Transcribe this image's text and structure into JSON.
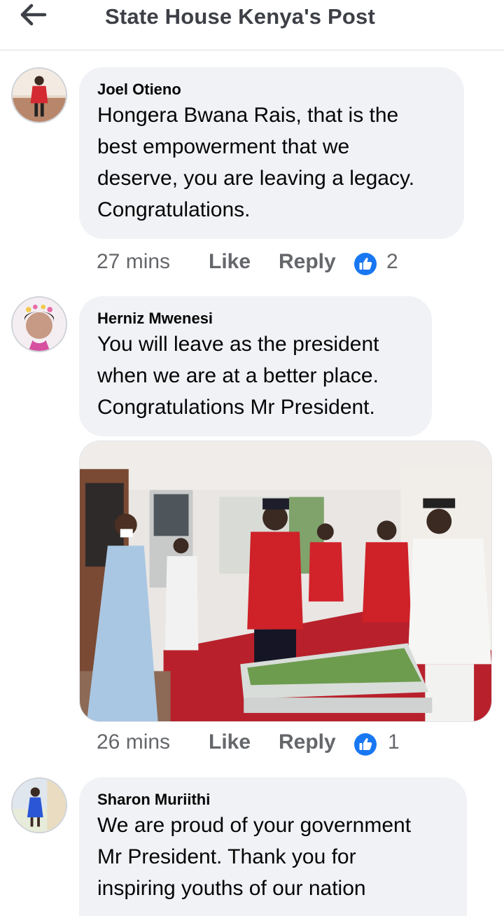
{
  "header": {
    "title": "State House Kenya's Post",
    "back_icon": "back-arrow-icon"
  },
  "comments": [
    {
      "author": "Joel Otieno",
      "text": "Hongera  Bwana Rais, that is the\nbest  empowerment that we\ndeserve, you are leaving a legacy.\nCongratulations.",
      "time": "27 mins",
      "like_label": "Like",
      "reply_label": "Reply",
      "reactions": "2"
    },
    {
      "author": "Herniz Mwenesi",
      "text": "You will leave as the president\nwhen we are at a better place.\nCongratulations Mr President.",
      "time": "26 mins",
      "like_label": "Like",
      "reply_label": "Reply",
      "reactions": "1"
    },
    {
      "author": "Sharon Muriithi",
      "text": "We are proud of your government\nMr President. Thank you for\ninspiring youths of our nation"
    }
  ],
  "colors": {
    "reaction_blue": "#1877f2",
    "bubble": "#f0f2f5",
    "meta_grey": "#65676b"
  }
}
